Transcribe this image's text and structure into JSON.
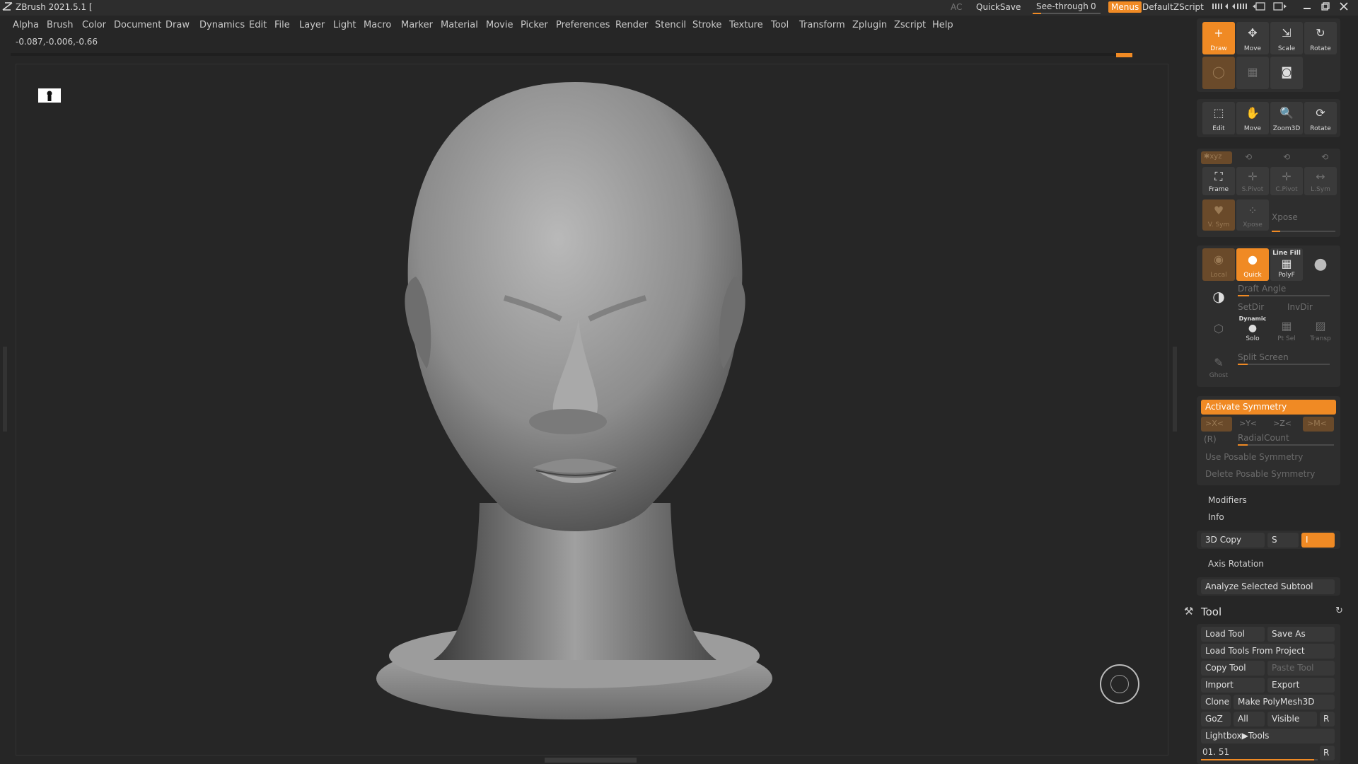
{
  "titlebar": {
    "app_title": "ZBrush 2021.5.1 [",
    "ac": "AC",
    "quicksave": "QuickSave",
    "see_through_label": "See-through",
    "see_through_value": "0",
    "see_through_level": 0,
    "menus": "Menus",
    "zscript": "DefaultZScript"
  },
  "menubar": {
    "items": [
      "Alpha",
      "Brush",
      "Color",
      "Document",
      "Draw",
      "Dynamics",
      "Edit",
      "File",
      "Layer",
      "Light",
      "Macro",
      "Marker",
      "Material",
      "Movie",
      "Picker",
      "Preferences",
      "Render",
      "Stencil",
      "Stroke",
      "Texture",
      "Tool",
      "Transform",
      "Zplugin",
      "Zscript",
      "Help"
    ]
  },
  "coords": "-0.087,-0.006,-0.66",
  "shelf": {
    "draw": "Draw",
    "move": "Move",
    "scale": "Scale",
    "rotate": "Rotate",
    "edit": "Edit",
    "move2": "Move",
    "zoom3d": "Zoom3D",
    "rotate2": "Rotate",
    "xyz": "✱xyz",
    "frame": "Frame",
    "spivot": "S.Pivot",
    "cpivot": "C.Pivot",
    "lsym": "L.Sym",
    "vsym": "V. Sym",
    "xpose_btn": "Xpose",
    "xpose": "Xpose",
    "local": "Local",
    "quick": "Quick",
    "linefill": "Line Fill",
    "polyf": "PolyF",
    "draft_angle": "Draft Angle",
    "setdir": "SetDir",
    "invdir": "InvDir",
    "dynamic": "Dynamic",
    "solo": "Solo",
    "ptsel": "Pt Sel",
    "transp": "Transp",
    "ghost": "Ghost",
    "split_screen": "Split Screen"
  },
  "symmetry": {
    "activate": "Activate Symmetry",
    "x": ">X<",
    "y": ">Y<",
    "z": ">Z<",
    "m": ">M<",
    "r": "(R)",
    "radial": "RadialCount",
    "posable": "Use Posable Symmetry",
    "delete_posable": "Delete Posable Symmetry"
  },
  "panel": {
    "modifiers": "Modifiers",
    "info": "Info",
    "copy3d": "3D Copy",
    "s": "S",
    "i": "I",
    "axis_rotation": "Axis Rotation",
    "analyze": "Analyze Selected Subtool"
  },
  "tool": {
    "title": "Tool",
    "load_tool": "Load Tool",
    "save_as": "Save As",
    "load_project": "Load Tools From Project",
    "copy_tool": "Copy Tool",
    "paste_tool": "Paste Tool",
    "import": "Import",
    "export": "Export",
    "clone": "Clone",
    "make_polymesh": "Make PolyMesh3D",
    "goz": "GoZ",
    "all": "All",
    "visible": "Visible",
    "r": "R",
    "lightbox": "Lightbox▶Tools",
    "slot": "01. 51",
    "r2": "R"
  }
}
